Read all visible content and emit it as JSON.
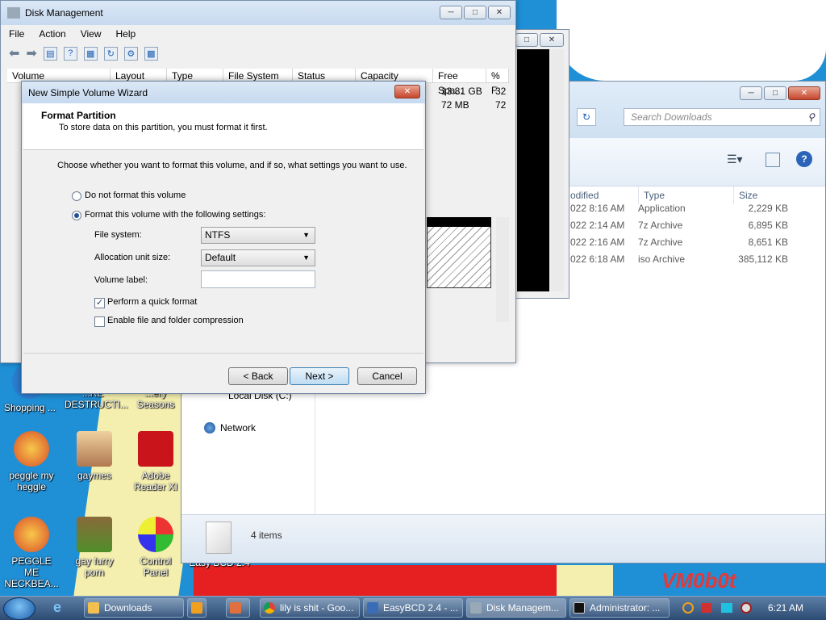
{
  "wallpaper": {
    "signature": "VM0b0t"
  },
  "disk_mgmt": {
    "title": "Disk Management",
    "menu": [
      "File",
      "Action",
      "View",
      "Help"
    ],
    "columns": [
      "Volume",
      "Layout",
      "Type",
      "File System",
      "Status",
      "Capacity",
      "Free Spa...",
      "% F"
    ],
    "rows": [
      {
        "free": "13.81 GB",
        "pct": "32"
      },
      {
        "free": "72 MB",
        "pct": "72"
      }
    ]
  },
  "explorer": {
    "search_placeholder": "Search Downloads",
    "headers": {
      "modified": "odified",
      "type": "Type",
      "size": "Size"
    },
    "files": [
      {
        "modified": "022 8:16 AM",
        "type": "Application",
        "size": "2,229 KB"
      },
      {
        "modified": "022 2:14 AM",
        "type": "7z Archive",
        "size": "6,895 KB"
      },
      {
        "modified": "022 2:16 AM",
        "type": "7z Archive",
        "size": "8,651 KB"
      },
      {
        "modified": "022 6:18 AM",
        "type": "iso Archive",
        "size": "385,112 KB"
      }
    ],
    "nav": {
      "local_disk": "Local Disk (C:)",
      "network": "Network"
    },
    "status": "4 items"
  },
  "wizard": {
    "title": "New Simple Volume Wizard",
    "heading": "Format Partition",
    "subheading": "To store data on this partition, you must format it first.",
    "instruction": "Choose whether you want to format this volume, and if so, what settings you want to use.",
    "opt_no_format": "Do not format this volume",
    "opt_format": "Format this volume with the following settings:",
    "fs_label": "File system:",
    "fs_value": "NTFS",
    "alloc_label": "Allocation unit size:",
    "alloc_value": "Default",
    "vol_label": "Volume label:",
    "vol_value": "",
    "quick_format": "Perform a quick format",
    "compression": "Enable file and folder compression",
    "back": "< Back",
    "next": "Next >",
    "cancel": "Cancel"
  },
  "desktop": {
    "icons": [
      {
        "label": "Shopping ..."
      },
      {
        "label": "...RE DESTRUCTI..."
      },
      {
        "label": "...ery Seasons"
      },
      {
        "label": "peggle my heggle"
      },
      {
        "label": "gaymes"
      },
      {
        "label": "Adobe Reader XI"
      },
      {
        "label": "PEGGLE ME NECKBEA..."
      },
      {
        "label": "gay furry porn"
      },
      {
        "label": "Control Panel"
      },
      {
        "label": "Easy BCD 2.4"
      }
    ]
  },
  "taskbar": {
    "items": [
      "Downloads",
      "lily is shit - Goo...",
      "EasyBCD 2.4 - ...",
      "Disk Managem...",
      "Administrator: ..."
    ],
    "clock": "6:21 AM"
  }
}
